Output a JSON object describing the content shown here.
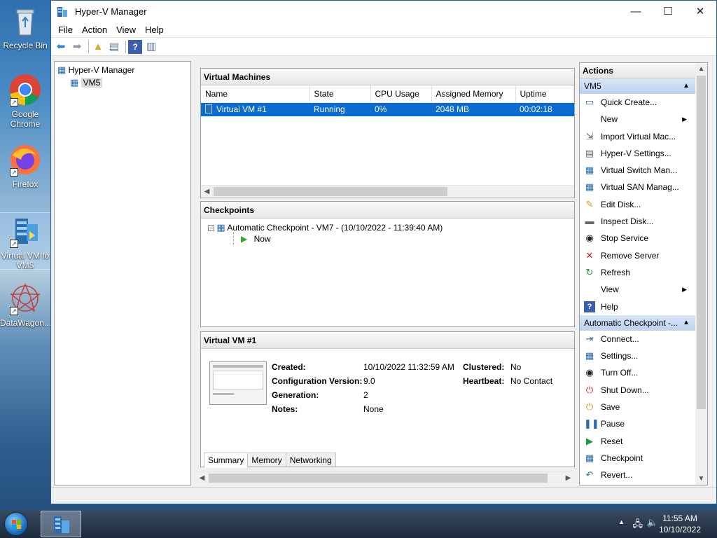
{
  "desktop": {
    "icons": [
      {
        "label": "Recycle Bin",
        "icon": "recycle-bin-icon"
      },
      {
        "label": "Google Chrome",
        "icon": "chrome-icon"
      },
      {
        "label": "Firefox",
        "icon": "firefox-icon"
      },
      {
        "label": "Virtual VM fo VM5",
        "icon": "hyperv-vm-icon"
      },
      {
        "label": "DataWagon...",
        "icon": "datawagon-icon"
      }
    ]
  },
  "window": {
    "title": "Hyper-V Manager",
    "controls": {
      "minimize": "—",
      "maximize": "☐",
      "close": "✕"
    }
  },
  "menu": [
    "File",
    "Action",
    "View",
    "Help"
  ],
  "tree": {
    "root": "Hyper-V Manager",
    "child": "VM5"
  },
  "vms": {
    "title": "Virtual Machines",
    "columns": [
      "Name",
      "State",
      "CPU Usage",
      "Assigned Memory",
      "Uptime"
    ],
    "rows": [
      {
        "name": "Virtual VM #1",
        "state": "Running",
        "cpu": "0%",
        "memory": "2048 MB",
        "uptime": "00:02:18"
      }
    ]
  },
  "checkpoints": {
    "title": "Checkpoints",
    "items": [
      "Automatic Checkpoint - VM7 - (10/10/2022 - 11:39:40 AM)",
      "Now"
    ]
  },
  "details": {
    "title": "Virtual VM #1",
    "fields": {
      "created_label": "Created:",
      "created": "10/10/2022 11:32:59 AM",
      "config_label": "Configuration Version:",
      "config": "9.0",
      "gen_label": "Generation:",
      "gen": "2",
      "notes_label": "Notes:",
      "notes": "None",
      "clustered_label": "Clustered:",
      "clustered": "No",
      "heartbeat_label": "Heartbeat:",
      "heartbeat": "No Contact"
    },
    "tabs": [
      "Summary",
      "Memory",
      "Networking"
    ]
  },
  "actions": {
    "title": "Actions",
    "group1": "VM5",
    "items1": [
      "Quick Create...",
      "New",
      "Import Virtual Mac...",
      "Hyper-V Settings...",
      "Virtual Switch Man...",
      "Virtual SAN Manag...",
      "Edit Disk...",
      "Inspect Disk...",
      "Stop Service",
      "Remove Server",
      "Refresh",
      "View",
      "Help"
    ],
    "group2": "Automatic Checkpoint -...",
    "items2": [
      "Connect...",
      "Settings...",
      "Turn Off...",
      "Shut Down...",
      "Save",
      "Pause",
      "Reset",
      "Checkpoint",
      "Revert..."
    ]
  },
  "taskbar": {
    "time": "11:55 AM",
    "date": "10/10/2022"
  }
}
